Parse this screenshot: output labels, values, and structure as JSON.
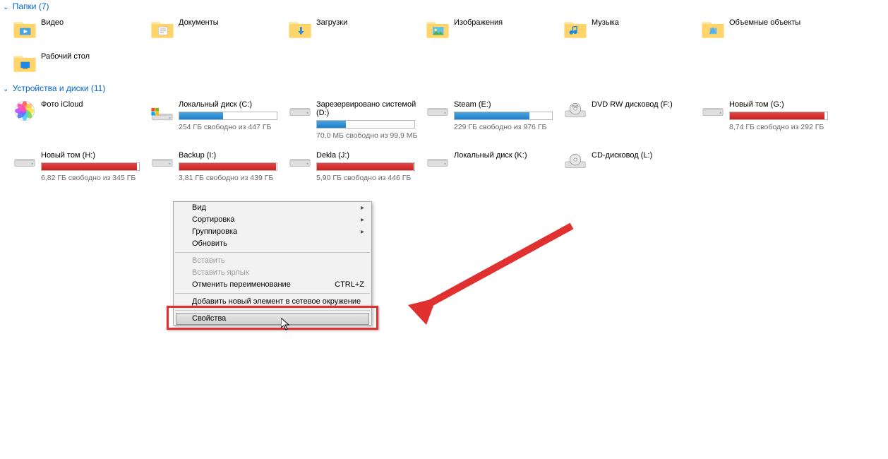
{
  "sections": {
    "folders": {
      "title": "Папки (7)",
      "items": [
        {
          "label": "Видео"
        },
        {
          "label": "Документы"
        },
        {
          "label": "Загрузки"
        },
        {
          "label": "Изображения"
        },
        {
          "label": "Музыка"
        },
        {
          "label": "Объемные объекты"
        },
        {
          "label": "Рабочий стол"
        }
      ]
    },
    "drives": {
      "title": "Устройства и диски (11)",
      "items": [
        {
          "label": "Фото iCloud",
          "kind": "app"
        },
        {
          "label": "Локальный диск (C:)",
          "kind": "drive",
          "sub": "254 ГБ свободно из 447 ГБ",
          "fill": 45,
          "color": "blue"
        },
        {
          "label": "Зарезервировано системой (D:)",
          "kind": "drive",
          "sub": "70,0 МБ свободно из 99,9 МБ",
          "fill": 30,
          "color": "blue"
        },
        {
          "label": "Steam (E:)",
          "kind": "drive",
          "sub": "229 ГБ свободно из 976 ГБ",
          "fill": 77,
          "color": "blue"
        },
        {
          "label": "DVD RW дисковод (F:)",
          "kind": "dvd"
        },
        {
          "label": "Новый том (G:)",
          "kind": "drive",
          "sub": "8,74 ГБ свободно из 292 ГБ",
          "fill": 97,
          "color": "red"
        },
        {
          "label": "Новый том (H:)",
          "kind": "drive",
          "sub": "6,82 ГБ свободно из 345 ГБ",
          "fill": 98,
          "color": "red"
        },
        {
          "label": "Backup (I:)",
          "kind": "drive",
          "sub": "3,81 ГБ свободно из 439 ГБ",
          "fill": 99,
          "color": "red"
        },
        {
          "label": "Dekla (J:)",
          "kind": "drive",
          "sub": "5,90 ГБ свободно из 446 ГБ",
          "fill": 99,
          "color": "red"
        },
        {
          "label": "Локальный диск (K:)",
          "kind": "drive-empty"
        },
        {
          "label": "CD-дисковод (L:)",
          "kind": "cd"
        }
      ]
    }
  },
  "context_menu": {
    "items": [
      {
        "label": "Вид",
        "submenu": true
      },
      {
        "label": "Сортировка",
        "submenu": true
      },
      {
        "label": "Группировка",
        "submenu": true
      },
      {
        "label": "Обновить"
      },
      {
        "sep": true
      },
      {
        "label": "Вставить",
        "disabled": true
      },
      {
        "label": "Вставить ярлык",
        "disabled": true
      },
      {
        "label": "Отменить переименование",
        "shortcut": "CTRL+Z"
      },
      {
        "sep": true
      },
      {
        "label": "Добавить новый элемент в сетевое окружение"
      },
      {
        "sep": true
      },
      {
        "label": "Свойства",
        "highlight": true
      }
    ]
  }
}
